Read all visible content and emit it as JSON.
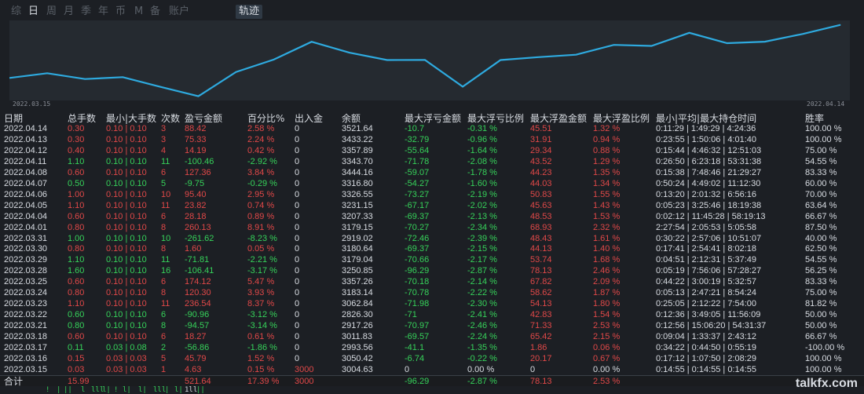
{
  "tabs": [
    {
      "label": "综",
      "active": false
    },
    {
      "label": "日",
      "active": true
    },
    {
      "label": "周",
      "active": false
    },
    {
      "label": "月",
      "active": false
    },
    {
      "label": "季",
      "active": false
    },
    {
      "label": "年",
      "active": false
    },
    {
      "label": "币",
      "active": false
    },
    {
      "label": "M",
      "active": false
    },
    {
      "label": "备",
      "active": false
    },
    {
      "label": "账户",
      "active": false
    }
  ],
  "trajectory_tab": "轨迹",
  "chart_data": {
    "type": "line",
    "x_start_label": "2022.03.15",
    "x_end_label": "2022.04.14",
    "x": [
      "2022.03.15",
      "2022.03.16",
      "2022.03.17",
      "2022.03.18",
      "2022.03.21",
      "2022.03.22",
      "2022.03.23",
      "2022.03.24",
      "2022.03.25",
      "2022.03.28",
      "2022.03.29",
      "2022.03.30",
      "2022.03.31",
      "2022.04.01",
      "2022.04.04",
      "2022.04.05",
      "2022.04.06",
      "2022.04.07",
      "2022.04.08",
      "2022.04.11",
      "2022.04.12",
      "2022.04.13",
      "2022.04.14"
    ],
    "values": [
      3004.63,
      3050.42,
      2993.56,
      3011.83,
      2917.26,
      2826.3,
      3062.84,
      3183.14,
      3357.26,
      3250.85,
      3179.04,
      3180.64,
      2919.02,
      3179.15,
      3207.33,
      3231.15,
      3326.55,
      3316.8,
      3444.16,
      3343.7,
      3357.89,
      3433.22,
      3521.64
    ],
    "ylim": [
      2800,
      3550
    ],
    "color": "#2eaadf"
  },
  "columns": [
    "日期",
    "总手数",
    "最小|大手数",
    "次数",
    "盈亏金额",
    "百分比%",
    "出入金",
    "余额",
    "最大浮亏金额",
    "最大浮亏比例",
    "最大浮盈金额",
    "最大浮盈比例",
    "最小|平均|最大持仓时间",
    "胜率"
  ],
  "rows": [
    [
      "2022.04.14",
      "0.30",
      "0.10 | 0.10",
      "3",
      "88.42",
      "2.58 %",
      "0",
      "3521.64",
      "-10.7",
      "-0.31 %",
      "45.51",
      "1.32 %",
      "0:11:29 | 1:49:29 | 4:24:36",
      "100.00 %"
    ],
    [
      "2022.04.13",
      "0.30",
      "0.10 | 0.10",
      "3",
      "75.33",
      "2.24 %",
      "0",
      "3433.22",
      "-32.79",
      "-0.96 %",
      "31.91",
      "0.94 %",
      "0:23:55 | 1:50:06 | 4:01:40",
      "100.00 %"
    ],
    [
      "2022.04.12",
      "0.40",
      "0.10 | 0.10",
      "4",
      "14.19",
      "0.42 %",
      "0",
      "3357.89",
      "-55.64",
      "-1.64 %",
      "29.34",
      "0.88 %",
      "0:15:44 | 4:46:32 | 12:51:03",
      "75.00 %"
    ],
    [
      "2022.04.11",
      "1.10",
      "0.10 | 0.10",
      "11",
      "-100.46",
      "-2.92 %",
      "0",
      "3343.70",
      "-71.78",
      "-2.08 %",
      "43.52",
      "1.29 %",
      "0:26:50 | 6:23:18 | 53:31:38",
      "54.55 %"
    ],
    [
      "2022.04.08",
      "0.60",
      "0.10 | 0.10",
      "6",
      "127.36",
      "3.84 %",
      "0",
      "3444.16",
      "-59.07",
      "-1.78 %",
      "44.23",
      "1.35 %",
      "0:15:38 | 7:48:46 | 21:29:27",
      "83.33 %"
    ],
    [
      "2022.04.07",
      "0.50",
      "0.10 | 0.10",
      "5",
      "-9.75",
      "-0.29 %",
      "0",
      "3316.80",
      "-54.27",
      "-1.60 %",
      "44.03",
      "1.34 %",
      "0:50:24 | 4:49:02 | 11:12:30",
      "60.00 %"
    ],
    [
      "2022.04.06",
      "1.00",
      "0.10 | 0.10",
      "10",
      "95.40",
      "2.95 %",
      "0",
      "3326.55",
      "-73.27",
      "-2.19 %",
      "50.83",
      "1.55 %",
      "0:13:20 | 2:01:32 | 6:56:16",
      "70.00 %"
    ],
    [
      "2022.04.05",
      "1.10",
      "0.10 | 0.10",
      "11",
      "23.82",
      "0.74 %",
      "0",
      "3231.15",
      "-67.17",
      "-2.02 %",
      "45.63",
      "1.43 %",
      "0:05:23 | 3:25:46 | 18:19:38",
      "63.64 %"
    ],
    [
      "2022.04.04",
      "0.60",
      "0.10 | 0.10",
      "6",
      "28.18",
      "0.89 %",
      "0",
      "3207.33",
      "-69.37",
      "-2.13 %",
      "48.53",
      "1.53 %",
      "0:02:12 | 11:45:28 | 58:19:13",
      "66.67 %"
    ],
    [
      "2022.04.01",
      "0.80",
      "0.10 | 0.10",
      "8",
      "260.13",
      "8.91 %",
      "0",
      "3179.15",
      "-70.27",
      "-2.34 %",
      "68.93",
      "2.32 %",
      "2:27:54 | 2:05:53 | 5:05:58",
      "87.50 %"
    ],
    [
      "2022.03.31",
      "1.00",
      "0.10 | 0.10",
      "10",
      "-261.62",
      "-8.23 %",
      "0",
      "2919.02",
      "-72.46",
      "-2.39 %",
      "48.43",
      "1.61 %",
      "0:30:22 | 2:57:06 | 10:51:07",
      "40.00 %"
    ],
    [
      "2022.03.30",
      "0.80",
      "0.10 | 0.10",
      "8",
      "1.60",
      "0.05 %",
      "0",
      "3180.64",
      "-69.37",
      "-2.15 %",
      "44.13",
      "1.40 %",
      "0:17:41 | 2:54:41 | 8:02:18",
      "62.50 %"
    ],
    [
      "2022.03.29",
      "1.10",
      "0.10 | 0.10",
      "11",
      "-71.81",
      "-2.21 %",
      "0",
      "3179.04",
      "-70.66",
      "-2.17 %",
      "53.74",
      "1.68 %",
      "0:04:51 | 2:12:31 | 5:37:49",
      "54.55 %"
    ],
    [
      "2022.03.28",
      "1.60",
      "0.10 | 0.10",
      "16",
      "-106.41",
      "-3.17 %",
      "0",
      "3250.85",
      "-96.29",
      "-2.87 %",
      "78.13",
      "2.46 %",
      "0:05:19 | 7:56:06 | 57:28:27",
      "56.25 %"
    ],
    [
      "2022.03.25",
      "0.60",
      "0.10 | 0.10",
      "6",
      "174.12",
      "5.47 %",
      "0",
      "3357.26",
      "-70.18",
      "-2.14 %",
      "67.82",
      "2.09 %",
      "0:44:22 | 3:00:19 | 5:32:57",
      "83.33 %"
    ],
    [
      "2022.03.24",
      "0.80",
      "0.10 | 0.10",
      "8",
      "120.30",
      "3.93 %",
      "0",
      "3183.14",
      "-70.78",
      "-2.22 %",
      "58.62",
      "1.87 %",
      "0:05:13 | 2:47:21 | 8:54:24",
      "75.00 %"
    ],
    [
      "2022.03.23",
      "1.10",
      "0.10 | 0.10",
      "11",
      "236.54",
      "8.37 %",
      "0",
      "3062.84",
      "-71.98",
      "-2.30 %",
      "54.13",
      "1.80 %",
      "0:25:05 | 2:12:22 | 7:54:00",
      "81.82 %"
    ],
    [
      "2022.03.22",
      "0.60",
      "0.10 | 0.10",
      "6",
      "-90.96",
      "-3.12 %",
      "0",
      "2826.30",
      "-71",
      "-2.41 %",
      "42.83",
      "1.54 %",
      "0:12:36 | 3:49:05 | 11:56:09",
      "50.00 %"
    ],
    [
      "2022.03.21",
      "0.80",
      "0.10 | 0.10",
      "8",
      "-94.57",
      "-3.14 %",
      "0",
      "2917.26",
      "-70.97",
      "-2.46 %",
      "71.33",
      "2.53 %",
      "0:12:56 | 15:06:20 | 54:31:37",
      "50.00 %"
    ],
    [
      "2022.03.18",
      "0.60",
      "0.10 | 0.10",
      "6",
      "18.27",
      "0.61 %",
      "0",
      "3011.83",
      "-69.57",
      "-2.24 %",
      "65.42",
      "2.15 %",
      "0:09:04 | 1:33:37 | 2:43:12",
      "66.67 %"
    ],
    [
      "2022.03.17",
      "0.11",
      "0.03 | 0.08",
      "2",
      "-56.86",
      "-1.86 %",
      "0",
      "2993.56",
      "-41.1",
      "-1.35 %",
      "1.86",
      "0.06 %",
      "0:34:22 | 0:44:50 | 0:55:19",
      "-100.00 %"
    ],
    [
      "2022.03.16",
      "0.15",
      "0.03 | 0.03",
      "5",
      "45.79",
      "1.52 %",
      "0",
      "3050.42",
      "-6.74",
      "-0.22 %",
      "20.17",
      "0.67 %",
      "0:17:12 | 1:07:50 | 2:08:29",
      "100.00 %"
    ],
    [
      "2022.03.15",
      "0.03",
      "0.03 | 0.03",
      "1",
      "4.63",
      "0.15 %",
      "3000",
      "3004.63",
      "0",
      "0.00 %",
      "0",
      "0.00 %",
      "0:14:55 | 0:14:55 | 0:14:55",
      "100.00 %"
    ]
  ],
  "total": {
    "label": "合计",
    "lots": "15.99",
    "profit": "521.64",
    "pct": "17.39 %",
    "deposit": "3000",
    "max_float_loss": "-96.29",
    "max_float_loss_pct": "-2.87 %",
    "max_float_profit": "78.13",
    "max_float_profit_pct": "2.53 %"
  },
  "watermark": "talkfx.com",
  "bottom_glyphs": [
    "!",
    "|",
    "||",
    "l",
    "lll",
    "l|",
    "!",
    "l|",
    "l|",
    "lll",
    "|",
    "l|",
    "1ll",
    "||"
  ]
}
